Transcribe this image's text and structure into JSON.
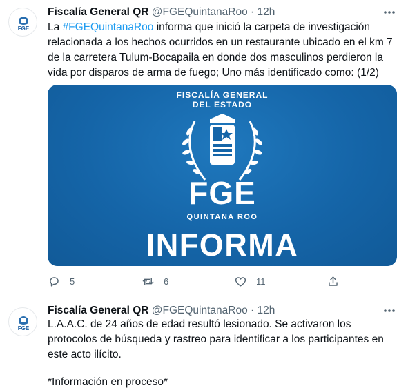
{
  "tweets": [
    {
      "author_name": "Fiscalía General QR",
      "handle": "@FGEQuintanaRoo",
      "separator": "·",
      "time": "12h",
      "hashtag": "#FGEQuintanaRoo",
      "text_before": "La ",
      "text_after": " informa que inició la carpeta de investigación relacionada a los hechos ocurridos en un restaurante ubicado en el km 7 de la carretera Tulum-Bocapaila en donde dos masculinos perdieron la vida por disparos de arma de fuego; Uno más identificado como: (1/2)",
      "media": {
        "title_line1": "FISCALÍA GENERAL",
        "title_line2": "DEL ESTADO",
        "logo_text": "FGE",
        "subtitle": "QUINTANA ROO",
        "banner": "INFORMA"
      },
      "actions": {
        "reply_count": "5",
        "retweet_count": "6",
        "like_count": "11"
      }
    },
    {
      "author_name": "Fiscalía General QR",
      "handle": "@FGEQuintanaRoo",
      "separator": "·",
      "time": "12h",
      "text": "L.A.A.C. de 24 años de edad resultó lesionado. Se activaron los protocolos de búsqueda y rastreo para identificar a los participantes en este acto ilícito.",
      "text2": "*Información en proceso*"
    }
  ],
  "avatar_text": "FGE",
  "icons": [
    "more-icon",
    "reply-icon",
    "retweet-icon",
    "like-icon",
    "share-icon"
  ],
  "colors": {
    "link": "#1d9bf0",
    "muted": "#536471",
    "media_bg": "#1565a8"
  }
}
